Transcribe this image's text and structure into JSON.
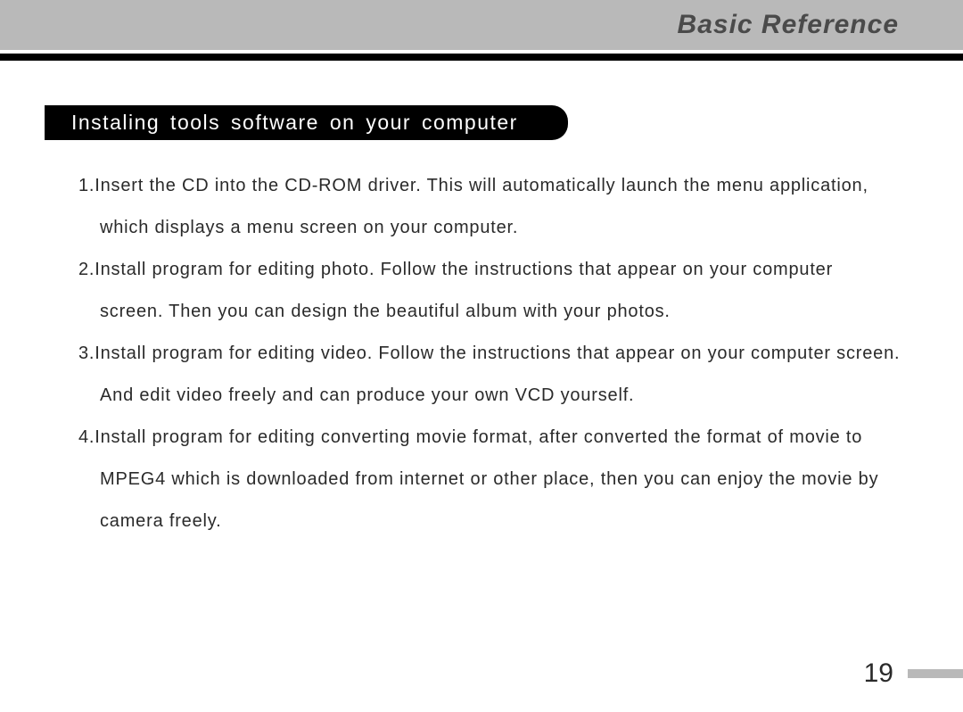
{
  "header": {
    "title": "Basic Reference"
  },
  "section": {
    "heading": "Instaling tools software on your computer"
  },
  "steps": [
    "1.Insert the CD into the CD-ROM driver. This will automatically launch the menu application, which displays a menu screen on your computer.",
    "2.Install program for editing photo. Follow the instructions that appear on your computer screen. Then you  can design the beautiful album with your photos.",
    "3.Install program for editing video. Follow the instructions that appear on your computer screen. And edit video freely and can produce your own VCD yourself.",
    "4.Install program for editing converting movie format, after converted the format of movie to MPEG4 which is downloaded from internet or other place, then you can enjoy the movie by camera freely."
  ],
  "pageNumber": "19"
}
